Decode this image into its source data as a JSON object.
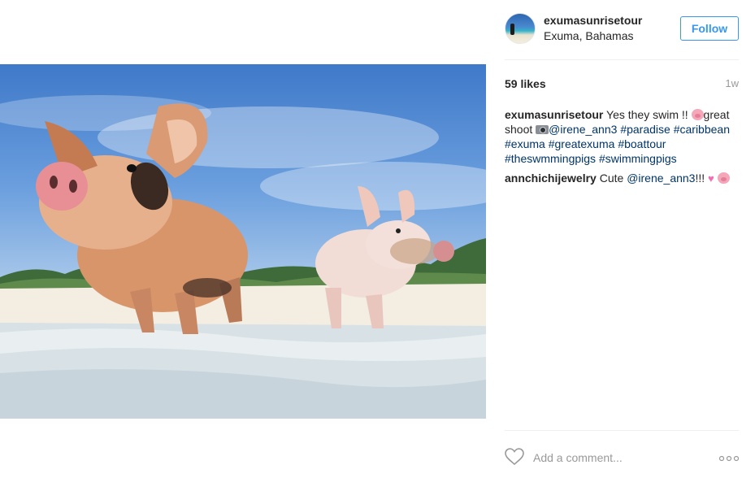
{
  "post": {
    "username": "exumasunrisetour",
    "location": "Exuma, Bahamas",
    "follow_label": "Follow",
    "image_alt": "Two pigs standing in shallow water on a beach",
    "likes": "59 likes",
    "time_ago": "1w"
  },
  "caption": {
    "username": "exumasunrisetour",
    "text1": "Yes they swim !! ",
    "text2": "great shoot ",
    "mention": "@irene_ann3",
    "hashtags": [
      "#paradise",
      "#caribbean",
      "#exuma",
      "#greatexuma",
      "#boattour",
      "#theswmmingpigs",
      "#swimmingpigs"
    ]
  },
  "comment1": {
    "username": "annchichijewelry",
    "text": "Cute ",
    "mention": "@irene_ann3",
    "suffix": "!!! "
  },
  "footer": {
    "comment_placeholder": "Add a comment..."
  },
  "icons": {
    "like": "heart-outline-icon",
    "more": "more-options-icon",
    "pig_emoji": "pig-face-emoji",
    "camera_emoji": "camera-emoji",
    "hearts_emoji": "two-hearts-emoji"
  },
  "colors": {
    "accent": "#3897f0",
    "link": "#003569",
    "muted": "#999999",
    "divider": "#efefef"
  }
}
